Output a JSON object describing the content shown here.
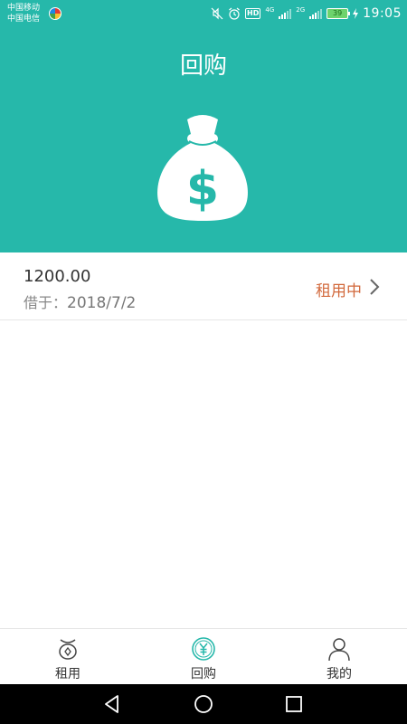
{
  "status_bar": {
    "carrier_1": "中国移动",
    "carrier_2": "中国电信",
    "hd": "HD",
    "net_1": "4G",
    "net_2": "2G",
    "battery": "39",
    "time": "19:05"
  },
  "header": {
    "title": "回购"
  },
  "records": [
    {
      "amount": "1200.00",
      "date_prefix": "借于：",
      "date": "2018/7/2",
      "status": "租用中"
    }
  ],
  "bottom_nav": {
    "items": [
      {
        "label": "租用",
        "icon": "rent-bag-icon"
      },
      {
        "label": "回购",
        "icon": "yuan-coin-icon"
      },
      {
        "label": "我的",
        "icon": "person-icon"
      }
    ]
  },
  "colors": {
    "primary": "#26b8aa",
    "status_accent": "#d2693c"
  }
}
